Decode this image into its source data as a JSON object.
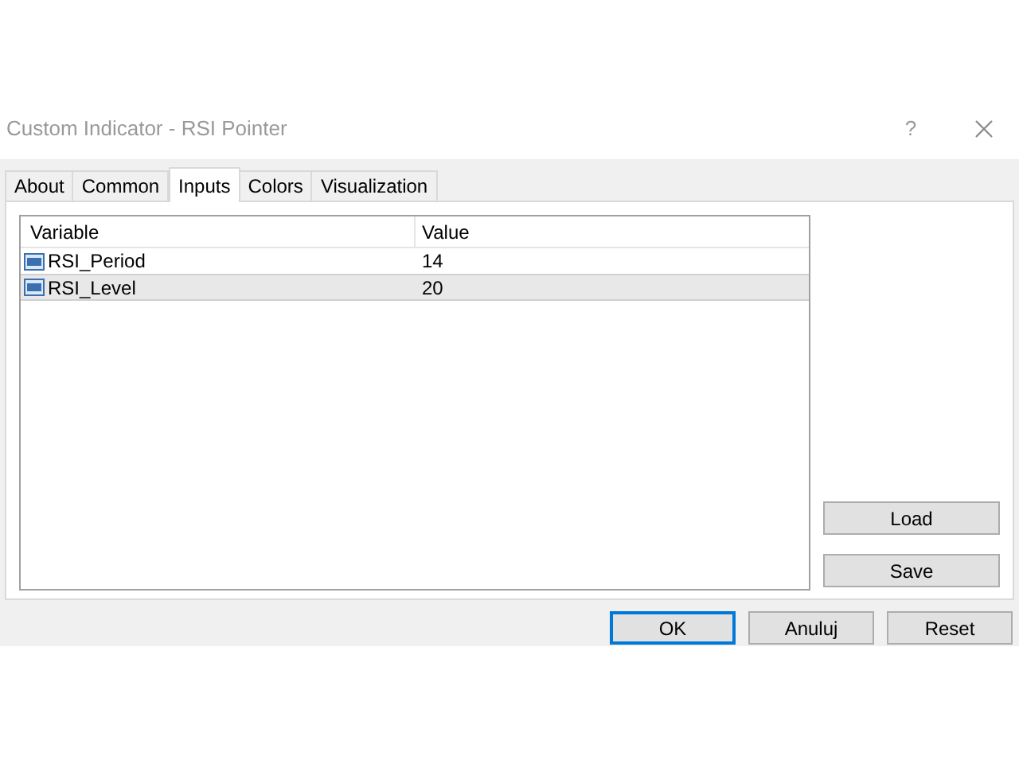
{
  "window": {
    "title": "Custom Indicator - RSI Pointer",
    "help": "?"
  },
  "tabs": [
    {
      "label": "About",
      "selected": false
    },
    {
      "label": "Common",
      "selected": false
    },
    {
      "label": "Inputs",
      "selected": true
    },
    {
      "label": "Colors",
      "selected": false
    },
    {
      "label": "Visualization",
      "selected": false
    }
  ],
  "table": {
    "columns": [
      "Variable",
      "Value"
    ],
    "rows": [
      {
        "variable": "RSI_Period",
        "value": "14",
        "selected": false
      },
      {
        "variable": "RSI_Level",
        "value": "20",
        "selected": true
      }
    ]
  },
  "side_buttons": [
    "Load",
    "Save"
  ],
  "buttons": [
    {
      "label": "OK",
      "default": true
    },
    {
      "label": "Anuluj",
      "default": false
    },
    {
      "label": "Reset",
      "default": false
    }
  ]
}
